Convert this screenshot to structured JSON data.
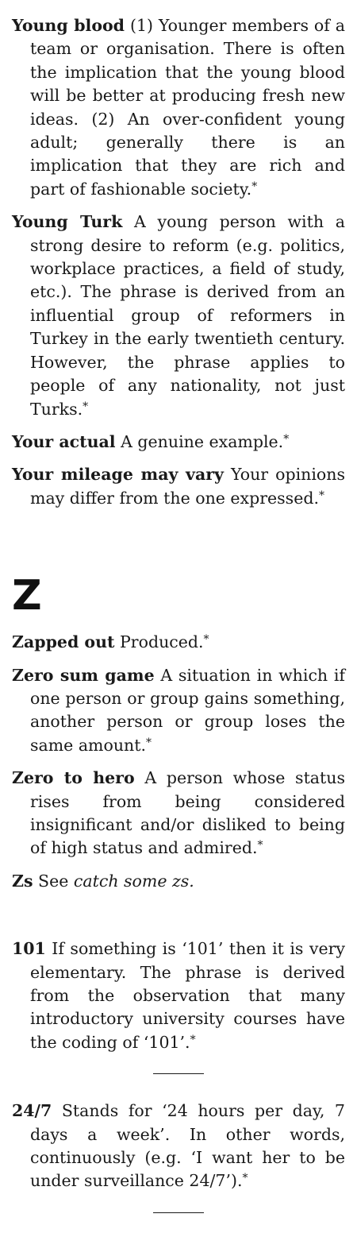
{
  "section_y": {
    "entries": [
      {
        "head": "Young blood",
        "body": "(1) Younger members of a team or organisation. There is often the implication that the young blood will be better at producing fresh new ideas. (2) An over-confident young adult; generally there is an implication that they are rich and part of fashionable society.",
        "star": "*"
      },
      {
        "head": "Young Turk",
        "body": "A young person with a strong desire to reform (e.g. politics, workplace practices, a field of study, etc.). The phrase is derived from an influential group of reformers in Turkey in the early twentieth century. However, the phrase applies to people of any nationality, not just Turks.",
        "star": "*"
      },
      {
        "head": "Your actual",
        "body": "A genuine example.",
        "star": "*"
      },
      {
        "head": "Your mileage may vary",
        "body": "Your opinions may differ from the one expressed.",
        "star": "*"
      }
    ]
  },
  "section_z": {
    "letter": "Z",
    "entries": [
      {
        "head": "Zapped out",
        "body": "Produced.",
        "star": "*"
      },
      {
        "head": "Zero sum game",
        "body": "A situation in which if one person or group gains something, another person or group loses the same amount.",
        "star": "*"
      },
      {
        "head": "Zero to hero",
        "body": "A person whose status rises from being considered insignificant and/or disliked to being of high status and admired.",
        "star": "*"
      },
      {
        "head": "Zs",
        "body": "See",
        "xref": "catch some zs."
      }
    ]
  },
  "section_num": {
    "entries": [
      {
        "head": "101",
        "body": "If something is ‘101’ then it is very elementary. The phrase is derived from the observation that many introductory university courses have the coding of ‘101’.",
        "star": "*"
      },
      {
        "head": "24/7",
        "body": "Stands for ‘24 hours per day, 7 days a week’. In other words, continuously (e.g. ‘I want her to be under surveillance 24/7’).",
        "star": "*"
      }
    ]
  }
}
